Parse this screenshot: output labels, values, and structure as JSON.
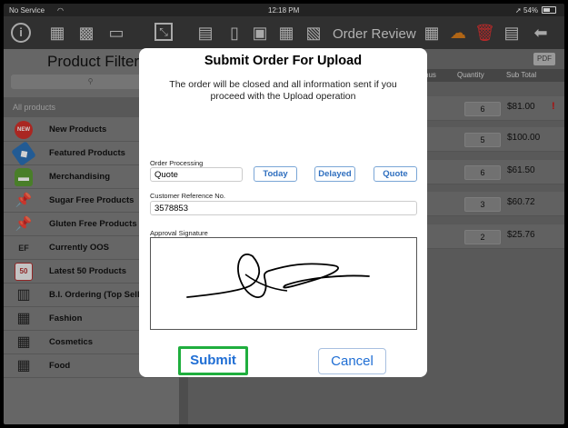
{
  "status_bar": {
    "carrier": "No Service",
    "time": "12:18 PM",
    "battery": "54%"
  },
  "toolbar": {
    "title": "Order Review",
    "icons": [
      "info-icon",
      "store-icon",
      "shop-icon",
      "display-icon",
      "edit-icon",
      "clipboard-icon",
      "device-icon",
      "doc-icon",
      "calculator-icon",
      "scan-icon",
      "calc-icon",
      "cloud-icon",
      "trash-icon",
      "notes-icon",
      "back-arrow-icon"
    ]
  },
  "sidebar": {
    "title": "Product Filter",
    "all_label": "All products",
    "items": [
      {
        "label": "New Products",
        "icon": "new-badge-icon",
        "color": "#d0302a",
        "glyph": "NEW"
      },
      {
        "label": "Featured Products",
        "icon": "tag-icon",
        "color": "#2a6fb5",
        "glyph": "◆"
      },
      {
        "label": "Merchandising",
        "icon": "basket-icon",
        "color": "#5a9a33",
        "glyph": "▬"
      },
      {
        "label": "Sugar Free Products",
        "icon": "pin-icon",
        "color": "#c83c3c",
        "glyph": "📌"
      },
      {
        "label": "Gluten Free Products",
        "icon": "pin-icon",
        "color": "#c83c3c",
        "glyph": "📌"
      },
      {
        "label": "Currently OOS",
        "icon": "oos-icon",
        "color": "#444",
        "glyph": "EF"
      },
      {
        "label": "Latest 50 Products",
        "icon": "calendar-50-icon",
        "color": "#b03030",
        "glyph": "50"
      },
      {
        "label": "B.I. Ordering (Top Selle",
        "icon": "bar-chart-icon",
        "color": "#333",
        "glyph": "▥"
      },
      {
        "label": "Fashion",
        "icon": "box-icon",
        "color": "#333",
        "glyph": "▦"
      },
      {
        "label": "Cosmetics",
        "icon": "box-icon",
        "color": "#333",
        "glyph": "▦"
      },
      {
        "label": "Food",
        "icon": "box-icon",
        "color": "#333",
        "glyph": "▦"
      }
    ]
  },
  "main": {
    "pdf_label": "PDF",
    "columns": [
      "nus",
      "Quantity",
      "Sub Total"
    ],
    "rows": [
      {
        "qty": "6",
        "subtotal": "$81.00",
        "flag": "!"
      },
      {
        "qty": "5",
        "subtotal": "$100.00"
      },
      {
        "qty": "6",
        "subtotal": "$61.50"
      },
      {
        "qty": "3",
        "subtotal": "$60.72"
      },
      {
        "qty": "2",
        "subtotal": "$25.76"
      }
    ]
  },
  "modal": {
    "title": "Submit Order For Upload",
    "message": "The order will be closed and all information sent if you proceed with the Upload operation",
    "order_processing_label": "Order Processing",
    "order_processing_value": "Quote",
    "option_buttons": [
      "Today",
      "Delayed",
      "Quote"
    ],
    "customer_ref_label": "Customer Reference No.",
    "customer_ref_value": "3578853",
    "signature_label": "Approval Signature",
    "submit_label": "Submit",
    "cancel_label": "Cancel"
  }
}
